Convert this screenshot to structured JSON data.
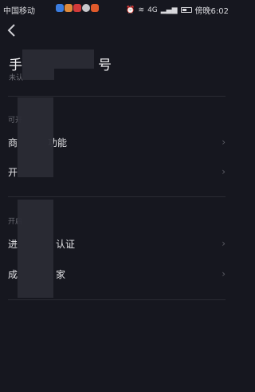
{
  "status_bar": {
    "carrier": "中国移动",
    "network": "4G",
    "time": "傍晚6:02",
    "icons": [
      "alarm-icon",
      "wifi-icon",
      "signal-icon",
      "battery-icon"
    ]
  },
  "header": {
    "back_icon": "chevron-left-icon",
    "title_visible_start": "手",
    "title_visible_end": "号",
    "subtitle_visible": "未认"
  },
  "sections": [
    {
      "title_visible": "可开",
      "items": [
        {
          "label_visible_start": "商",
          "label_visible_end": "功能"
        },
        {
          "label_visible_start": "开"
        }
      ]
    },
    {
      "title_visible": "开启",
      "items": [
        {
          "label_visible_start": "进",
          "label_visible_end": "认证"
        },
        {
          "label_visible_start": "成",
          "label_visible_end": "家"
        }
      ]
    }
  ],
  "colors": {
    "background": "#16171f",
    "text_primary": "#e4e4e7",
    "text_secondary": "#6b6c74",
    "divider": "#2a2b33",
    "redaction": "#2a2b35"
  }
}
